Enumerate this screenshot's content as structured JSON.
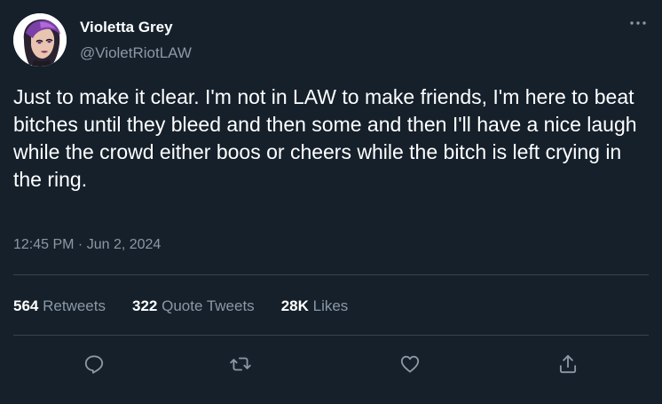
{
  "author": {
    "display_name": "Violetta Grey",
    "handle": "@VioletRiotLAW",
    "avatar_icon": "avatar-icon"
  },
  "tweet": {
    "text": "Just to make it clear. I'm not in LAW to make friends, I'm here to beat bitches until they bleed and then some and then I'll have a nice laugh while the crowd either boos or cheers while the bitch is left crying in the ring.",
    "timestamp": "12:45 PM · Jun 2, 2024"
  },
  "stats": {
    "retweets": {
      "count": "564",
      "label": "Retweets"
    },
    "quote_tweets": {
      "count": "322",
      "label": "Quote Tweets"
    },
    "likes": {
      "count": "28K",
      "label": "Likes"
    }
  },
  "actions": {
    "reply_icon": "reply-icon",
    "retweet_icon": "retweet-icon",
    "like_icon": "like-icon",
    "share_icon": "share-icon",
    "more_icon": "more-icon"
  },
  "colors": {
    "background": "#15202b",
    "primary_text": "#ffffff",
    "secondary_text": "#8b98a5",
    "divider": "#38444d"
  }
}
